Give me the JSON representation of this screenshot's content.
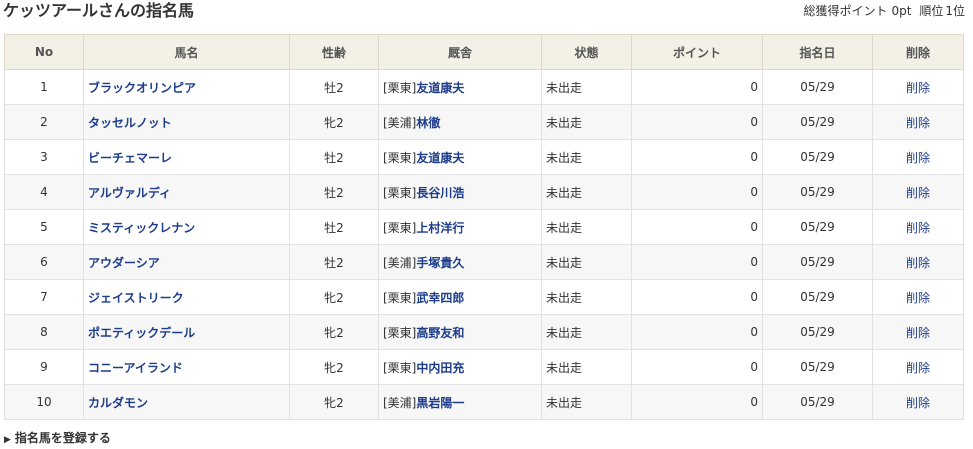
{
  "header": {
    "title": "ケッツアールさんの指名馬",
    "total_points_label": "総獲得ポイント",
    "total_points": "0pt",
    "rank_label": "順位",
    "rank": "1位"
  },
  "table": {
    "headers": {
      "no": "No",
      "horse": "馬名",
      "sex_age": "性齢",
      "stable": "厩舎",
      "status": "状態",
      "points": "ポイント",
      "date": "指名日",
      "delete": "削除"
    },
    "rows": [
      {
        "no": "1",
        "horse": "ブラックオリンピア",
        "sex_age": "牡2",
        "region": "[栗東]",
        "trainer": "友道康夫",
        "status": "未出走",
        "points": "0",
        "date": "05/29",
        "delete": "削除"
      },
      {
        "no": "2",
        "horse": "タッセルノット",
        "sex_age": "牝2",
        "region": "[美浦]",
        "trainer": "林徹",
        "status": "未出走",
        "points": "0",
        "date": "05/29",
        "delete": "削除"
      },
      {
        "no": "3",
        "horse": "ビーチェマーレ",
        "sex_age": "牡2",
        "region": "[栗東]",
        "trainer": "友道康夫",
        "status": "未出走",
        "points": "0",
        "date": "05/29",
        "delete": "削除"
      },
      {
        "no": "4",
        "horse": "アルヴァルディ",
        "sex_age": "牡2",
        "region": "[栗東]",
        "trainer": "長谷川浩",
        "status": "未出走",
        "points": "0",
        "date": "05/29",
        "delete": "削除"
      },
      {
        "no": "5",
        "horse": "ミスティックレナン",
        "sex_age": "牡2",
        "region": "[栗東]",
        "trainer": "上村洋行",
        "status": "未出走",
        "points": "0",
        "date": "05/29",
        "delete": "削除"
      },
      {
        "no": "6",
        "horse": "アウダーシア",
        "sex_age": "牡2",
        "region": "[美浦]",
        "trainer": "手塚貴久",
        "status": "未出走",
        "points": "0",
        "date": "05/29",
        "delete": "削除"
      },
      {
        "no": "7",
        "horse": "ジェイストリーク",
        "sex_age": "牝2",
        "region": "[栗東]",
        "trainer": "武幸四郎",
        "status": "未出走",
        "points": "0",
        "date": "05/29",
        "delete": "削除"
      },
      {
        "no": "8",
        "horse": "ポエティックデール",
        "sex_age": "牝2",
        "region": "[栗東]",
        "trainer": "高野友和",
        "status": "未出走",
        "points": "0",
        "date": "05/29",
        "delete": "削除"
      },
      {
        "no": "9",
        "horse": "コニーアイランド",
        "sex_age": "牝2",
        "region": "[栗東]",
        "trainer": "中内田充",
        "status": "未出走",
        "points": "0",
        "date": "05/29",
        "delete": "削除"
      },
      {
        "no": "10",
        "horse": "カルダモン",
        "sex_age": "牝2",
        "region": "[美浦]",
        "trainer": "黒岩陽一",
        "status": "未出走",
        "points": "0",
        "date": "05/29",
        "delete": "削除"
      }
    ]
  },
  "footer": {
    "register_icon": "triangle-right-icon",
    "register_label": "指名馬を登録する"
  }
}
